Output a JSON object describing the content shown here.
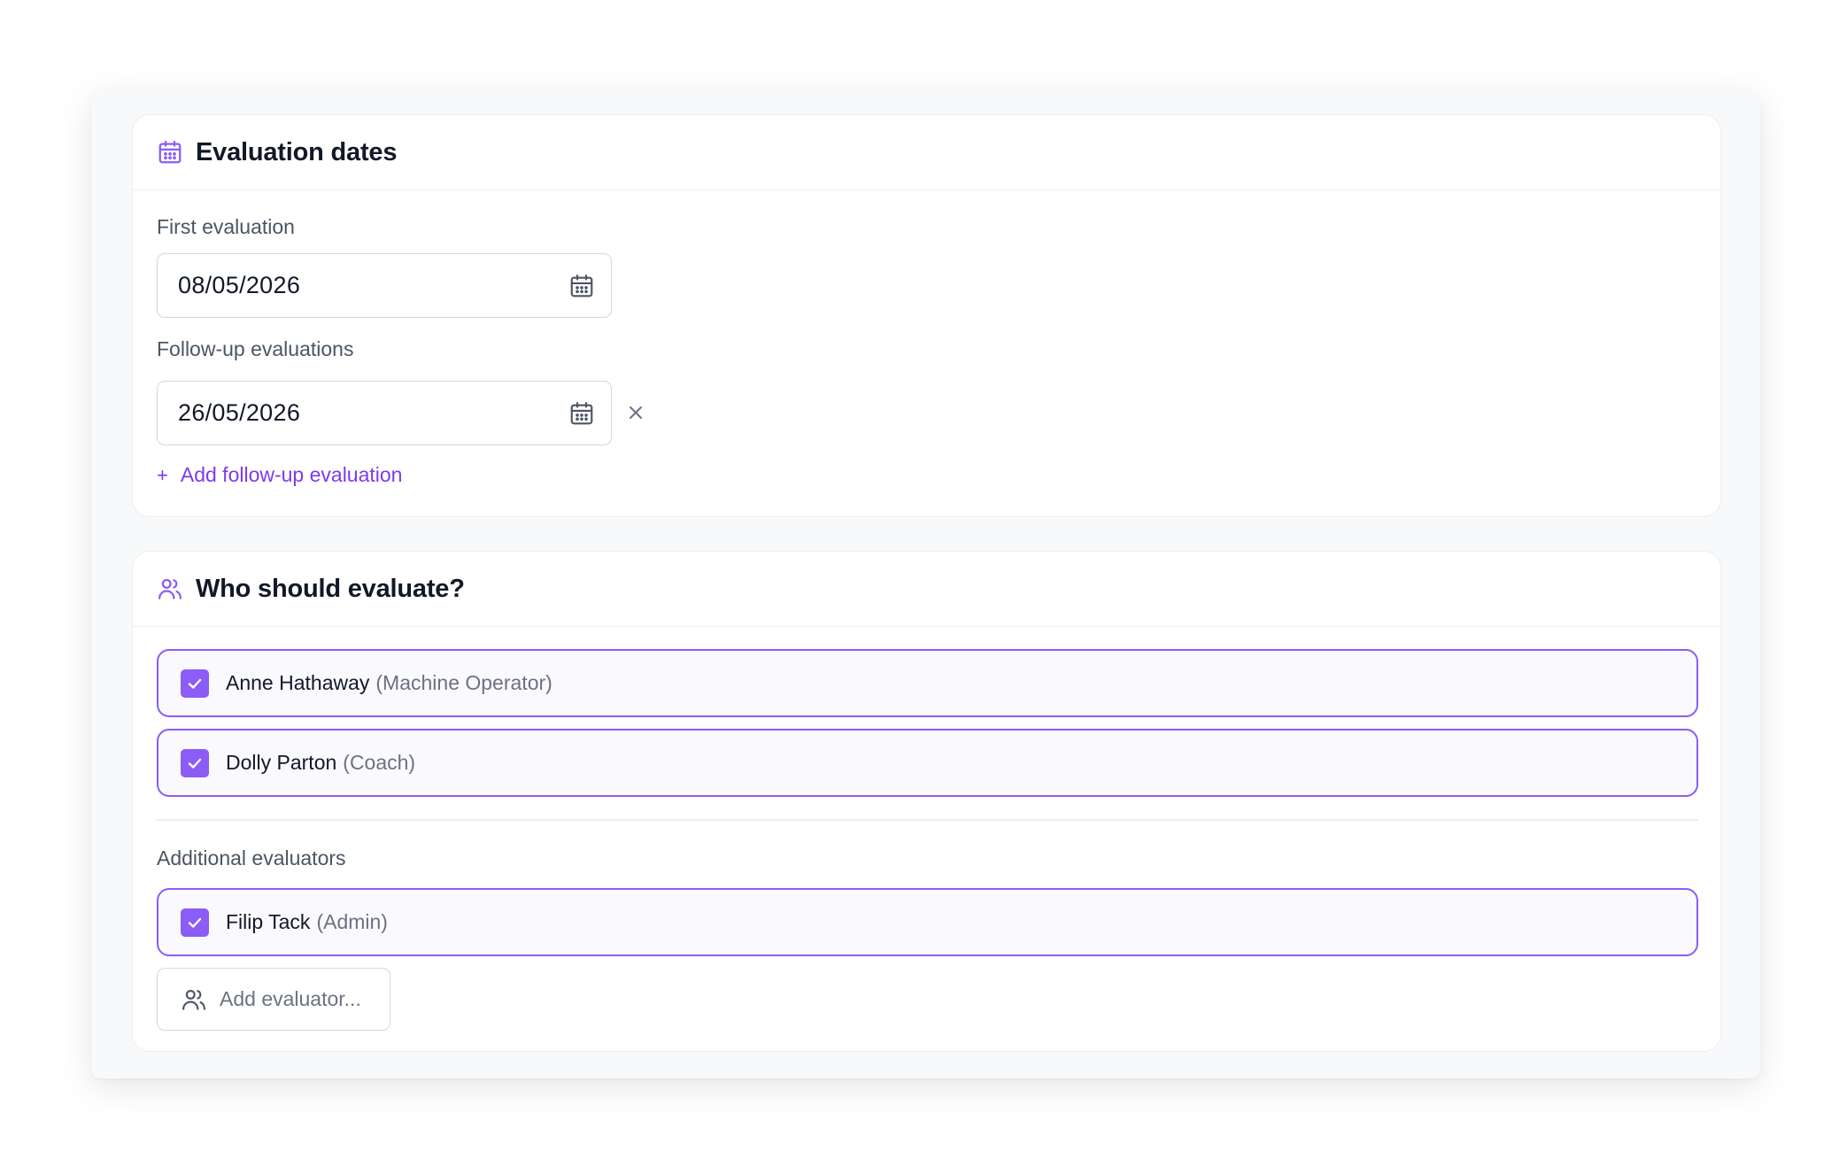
{
  "dates_section": {
    "title": "Evaluation dates",
    "icon": "calendar-icon",
    "first_evaluation": {
      "label": "First evaluation",
      "value": "08/05/2026"
    },
    "follow_up": {
      "label": "Follow-up evaluations",
      "values": [
        "26/05/2026"
      ]
    },
    "add_follow_up": {
      "plus": "+",
      "label": "Add follow-up evaluation"
    }
  },
  "evaluators_section": {
    "title": "Who should evaluate?",
    "icon": "users-icon",
    "evaluators": [
      {
        "name": "Anne Hathaway",
        "role": "(Machine Operator)",
        "checked": true
      },
      {
        "name": "Dolly Parton",
        "role": "(Coach)",
        "checked": true
      }
    ],
    "additional": {
      "label": "Additional evaluators",
      "evaluators": [
        {
          "name": "Filip Tack",
          "role": "(Admin)",
          "checked": true
        }
      ]
    },
    "add_evaluator": {
      "label": "Add evaluator...",
      "icon": "users-icon"
    }
  },
  "colors": {
    "accent": "#8b5cf6",
    "link": "#7c3aed",
    "text": "#111827",
    "muted": "#6b7280"
  }
}
